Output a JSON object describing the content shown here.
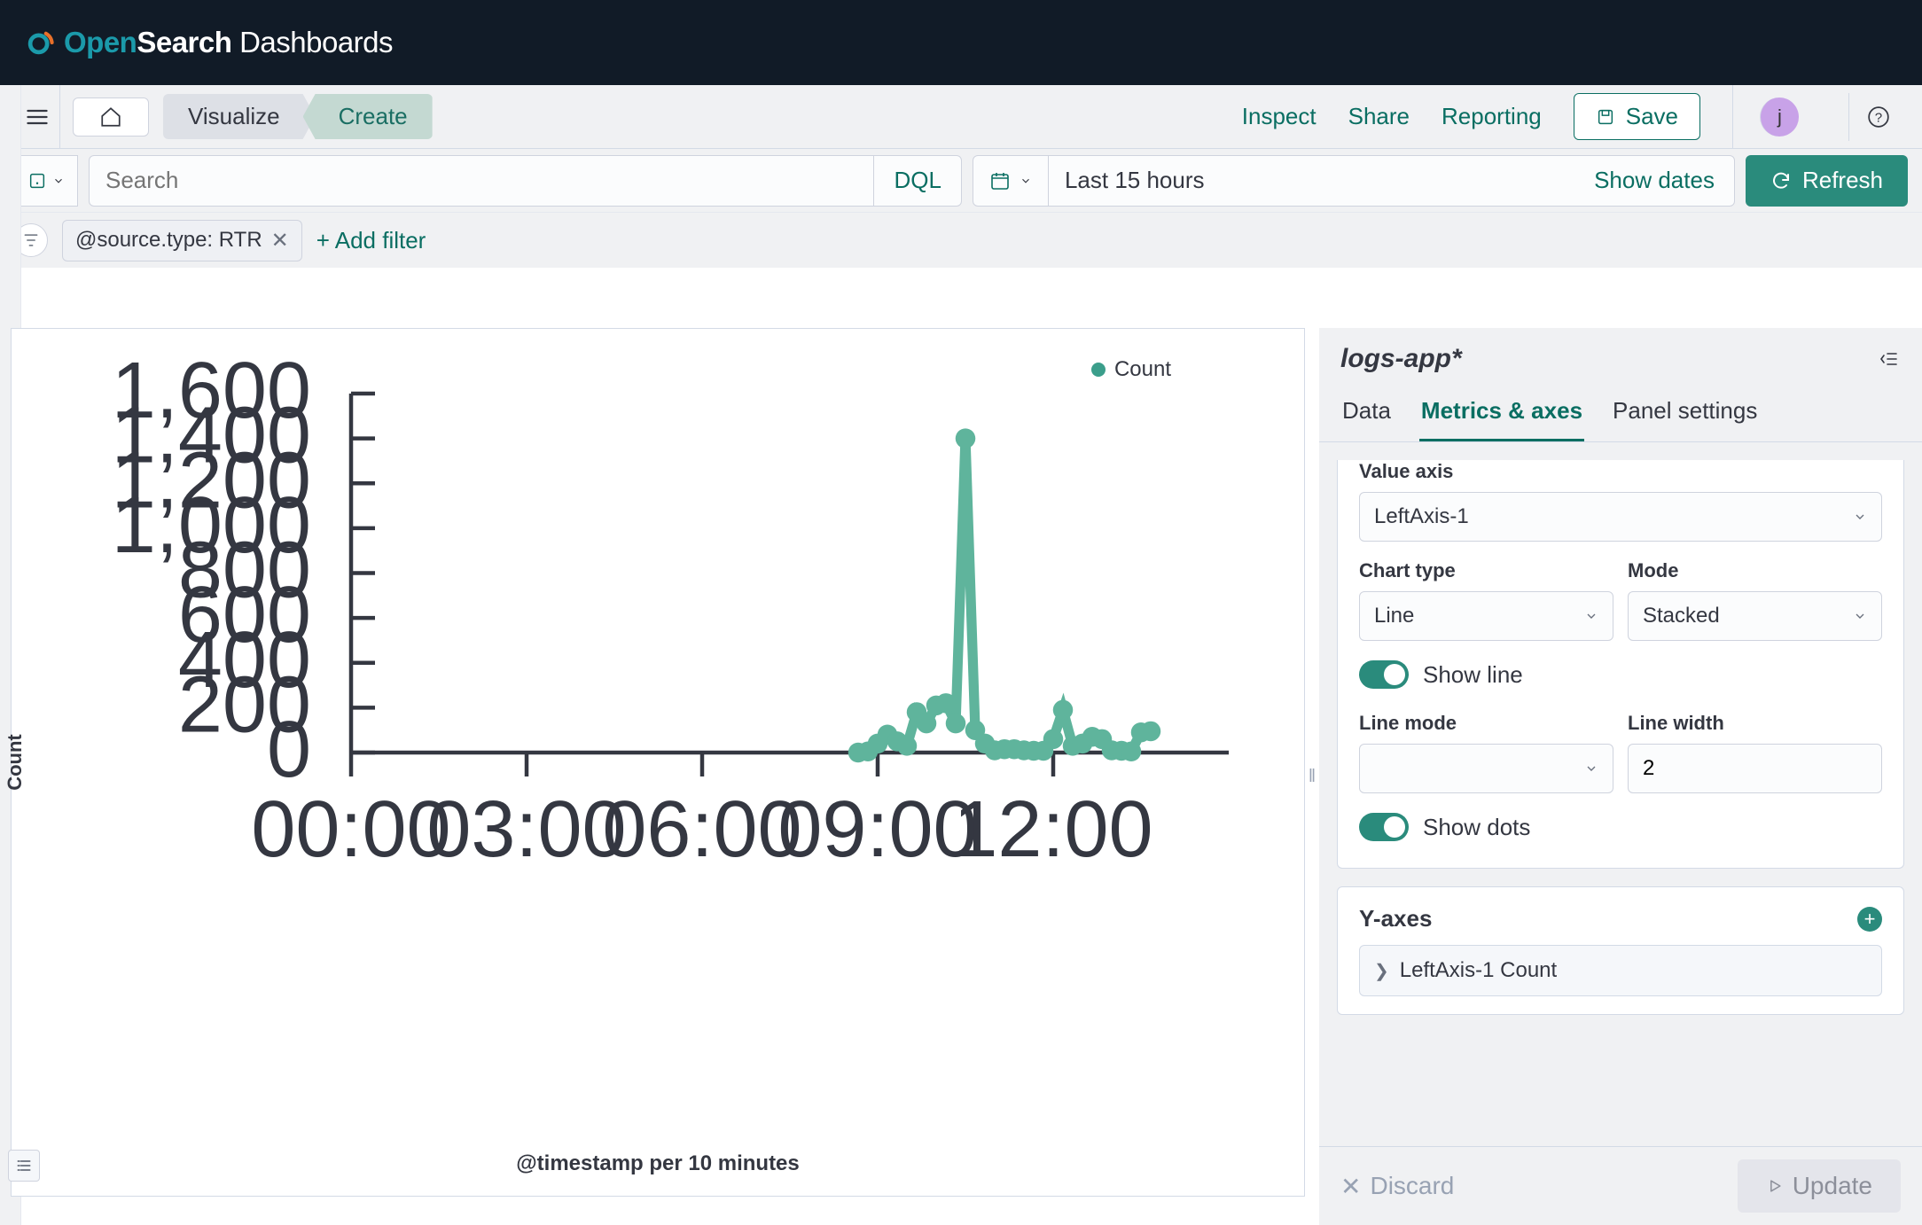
{
  "brand": {
    "open": "Open",
    "search": "Search",
    "dashboards": " Dashboards"
  },
  "nav": {
    "breadcrumb": [
      "Visualize",
      "Create"
    ],
    "links": {
      "inspect": "Inspect",
      "share": "Share",
      "reporting": "Reporting",
      "save": "Save"
    },
    "avatar": "j"
  },
  "query": {
    "placeholder": "Search",
    "dql": "DQL",
    "time_range": "Last 15 hours",
    "show_dates": "Show dates",
    "refresh": "Refresh"
  },
  "filters": {
    "pill": "@source.type: RTR",
    "add": "+ Add filter"
  },
  "config": {
    "index": "logs-app*",
    "tabs": {
      "data": "Data",
      "metrics": "Metrics & axes",
      "panel": "Panel settings"
    },
    "value_axis": {
      "label": "Value axis",
      "value": "LeftAxis-1"
    },
    "chart_type": {
      "label": "Chart type",
      "value": "Line"
    },
    "mode": {
      "label": "Mode",
      "value": "Stacked"
    },
    "show_line": "Show line",
    "line_mode": {
      "label": "Line mode",
      "value": ""
    },
    "line_width": {
      "label": "Line width",
      "value": "2"
    },
    "show_dots": "Show dots",
    "yaxes": {
      "title": "Y-axes",
      "item": "LeftAxis-1 Count"
    },
    "discard": "Discard",
    "update": "Update"
  },
  "chart_data": {
    "type": "line",
    "title": "",
    "ylabel": "Count",
    "xlabel": "@timestamp per 10 minutes",
    "legend": "Count",
    "ylim": [
      0,
      1600
    ],
    "y_ticks": [
      0,
      200,
      400,
      600,
      800,
      1000,
      1200,
      1400,
      1600
    ],
    "x_ticks": [
      "00:00",
      "03:00",
      "06:00",
      "09:00",
      "12:00"
    ],
    "series": [
      {
        "name": "Count",
        "color": "#5fb49c",
        "x": [
          "08:40",
          "08:50",
          "09:00",
          "09:10",
          "09:20",
          "09:30",
          "09:40",
          "09:50",
          "10:00",
          "10:10",
          "10:20",
          "10:30",
          "10:40",
          "10:50",
          "11:00",
          "11:10",
          "11:20",
          "11:30",
          "11:40",
          "11:50",
          "12:00",
          "12:10",
          "12:20",
          "12:30",
          "12:40",
          "12:50",
          "13:00",
          "13:10",
          "13:20",
          "13:30",
          "13:40"
        ],
        "y": [
          0,
          5,
          40,
          80,
          50,
          30,
          180,
          130,
          210,
          220,
          130,
          1400,
          100,
          40,
          10,
          15,
          15,
          10,
          8,
          8,
          60,
          190,
          30,
          40,
          70,
          60,
          10,
          8,
          5,
          90,
          95
        ]
      }
    ]
  }
}
